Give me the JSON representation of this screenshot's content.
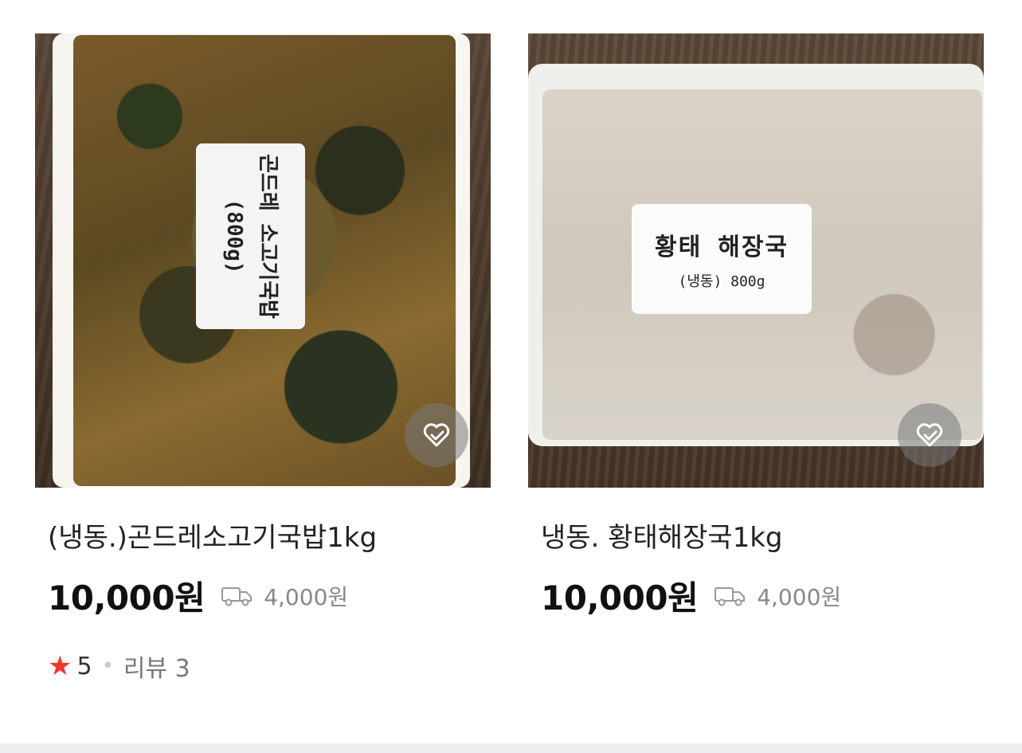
{
  "products": [
    {
      "image_label_line1": "곤드레 소고기국밥",
      "image_label_line2": "(800g)",
      "title": "(냉동.)곤드레소고기국밥1kg",
      "price": "10,000원",
      "shipping": "4,000원",
      "rating": "5",
      "reviews": "리뷰 3"
    },
    {
      "image_label_line1": "황태 해장국",
      "image_label_line2": "(냉동) 800g",
      "title": "냉동. 황태해장국1kg",
      "price": "10,000원",
      "shipping": "4,000원"
    }
  ],
  "icons": {
    "wishlist": "heart-check-icon",
    "shipping": "truck-icon",
    "rating": "star-icon"
  },
  "colors": {
    "star": "#f2372b",
    "muted": "#888888"
  }
}
